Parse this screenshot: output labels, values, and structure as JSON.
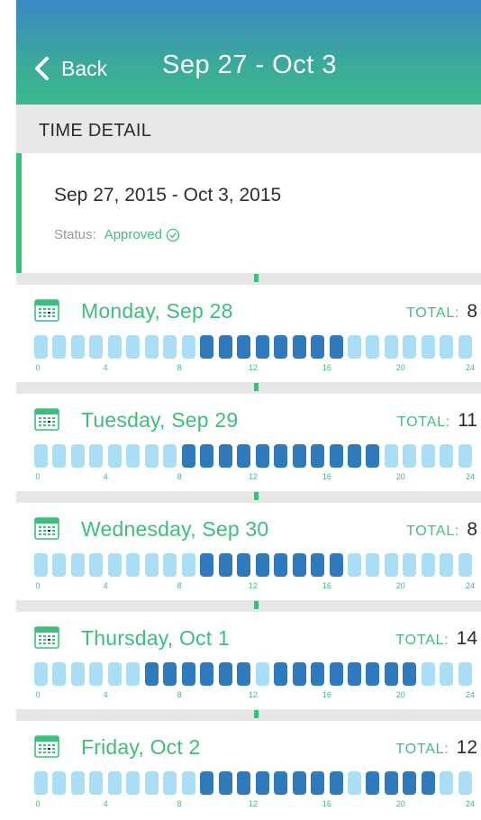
{
  "header": {
    "back_label": "Back",
    "title": "Sep 27 - Oct 3"
  },
  "section": {
    "title": "TIME DETAIL"
  },
  "summary": {
    "date_range": "Sep 27, 2015 - Oct 3, 2015",
    "status_label": "Status:",
    "status_value": "Approved"
  },
  "total_label": "TOTAL:",
  "hour_ticks": [
    "0",
    "4",
    "8",
    "12",
    "16",
    "20",
    "24"
  ],
  "days": [
    {
      "title": "Monday, Sep 28",
      "total": "8",
      "worked_hours": [
        9,
        10,
        11,
        12,
        13,
        14,
        15,
        16
      ]
    },
    {
      "title": "Tuesday, Sep 29",
      "total": "11",
      "worked_hours": [
        8,
        9,
        10,
        11,
        12,
        13,
        14,
        15,
        16,
        17,
        18
      ]
    },
    {
      "title": "Wednesday, Sep 30",
      "total": "8",
      "worked_hours": [
        9,
        10,
        11,
        12,
        13,
        14,
        15,
        16
      ]
    },
    {
      "title": "Thursday, Oct 1",
      "total": "14",
      "worked_hours": [
        6,
        7,
        8,
        9,
        10,
        11,
        13,
        14,
        15,
        16,
        17,
        18,
        19,
        20
      ]
    },
    {
      "title": "Friday, Oct 2",
      "total": "12",
      "worked_hours": [
        9,
        10,
        11,
        12,
        13,
        14,
        15,
        16,
        18,
        19,
        20,
        21
      ]
    }
  ],
  "colors": {
    "accent_green": "#3cbf7d",
    "worked": "#2f79bd",
    "idle": "#a9def5",
    "header_top": "#3a89c4",
    "header_bottom": "#3bb98b"
  },
  "icons": {
    "back": "chevron-left-icon",
    "status": "check-circle-icon",
    "day": "calendar-icon"
  }
}
